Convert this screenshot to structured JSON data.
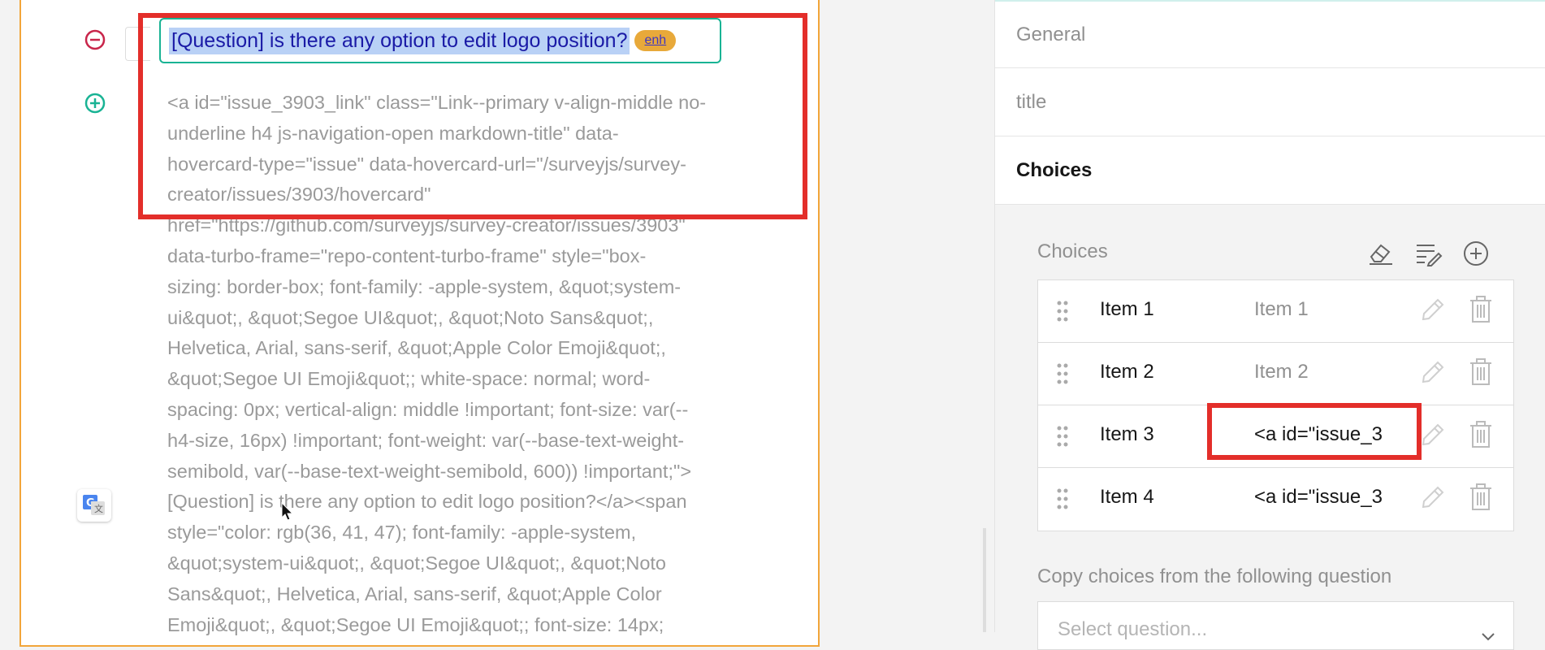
{
  "question": {
    "title": "[Question] is there any option to edit logo position?",
    "badge": "enh",
    "description": "<a id=\"issue_3903_link\" class=\"Link--primary v-align-middle no-\nunderline h4 js-navigation-open markdown-title\" data-\nhovercard-type=\"issue\" data-hovercard-url=\"/surveyjs/survey-\ncreator/issues/3903/hovercard\"\nhref=\"https://github.com/surveyjs/survey-creator/issues/3903\"\ndata-turbo-frame=\"repo-content-turbo-frame\" style=\"box-\nsizing: border-box; font-family: -apple-system, &quot;system-\nui&quot;, &quot;Segoe UI&quot;, &quot;Noto Sans&quot;,\nHelvetica, Arial, sans-serif, &quot;Apple Color Emoji&quot;,\n&quot;Segoe UI Emoji&quot;; white-space: normal; word-\nspacing: 0px; vertical-align: middle !important; font-size: var(--\nh4-size, 16px) !important; font-weight: var(--base-text-weight-\nsemibold, var(--base-text-weight-semibold, 600)) !important;\">\n[Question] is there any option to edit logo position?</a><span\nstyle=\"color: rgb(36, 41, 47); font-family: -apple-system,\n&quot;system-ui&quot;, &quot;Segoe UI&quot;, &quot;Noto\nSans&quot;, Helvetica, Arial, sans-serif, &quot;Apple Color\nEmoji&quot;, &quot;Segoe UI Emoji&quot;; font-size: 14px;"
  },
  "properties": {
    "sections": [
      "General",
      "title",
      "Choices"
    ],
    "choices_label": "Choices",
    "choices": [
      {
        "value": "Item 1",
        "text": "Item 1",
        "filled": false
      },
      {
        "value": "Item 2",
        "text": "Item 2",
        "filled": false
      },
      {
        "value": "Item 3",
        "text": "<a id=\"issue_3",
        "filled": true
      },
      {
        "value": "Item 4",
        "text": "<a id=\"issue_3",
        "filled": true
      }
    ],
    "copy_label": "Copy choices from the following question",
    "select_placeholder": "Select question..."
  },
  "colors": {
    "accent": "#19b394",
    "card_border": "#f2a53a",
    "highlight_box": "#e32e2a",
    "remove_icon": "#c8254a",
    "badge_bg": "#e8a93a"
  },
  "icons": [
    "remove-circle-icon",
    "add-circle-icon",
    "google-translate-icon",
    "mouse-cursor-icon",
    "eraser-icon",
    "edit-list-icon",
    "add-icon",
    "drag-handle-icon",
    "pencil-icon",
    "trash-icon",
    "chevron-down-icon"
  ]
}
